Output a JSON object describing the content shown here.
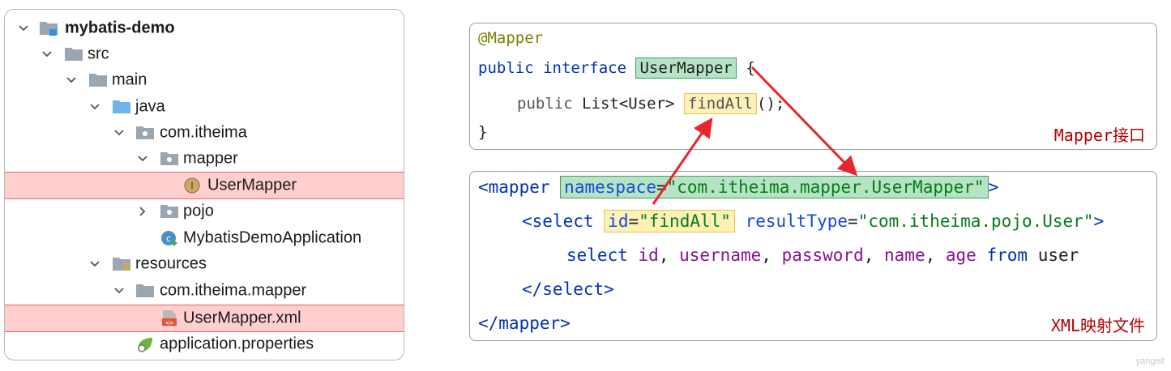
{
  "tree": {
    "items": [
      {
        "label": "mybatis-demo",
        "icon": "module-folder-icon",
        "expanded": true
      },
      {
        "label": "src",
        "icon": "folder-icon",
        "expanded": true
      },
      {
        "label": "main",
        "icon": "folder-icon",
        "expanded": true
      },
      {
        "label": "java",
        "icon": "source-folder-icon",
        "expanded": true
      },
      {
        "label": "com.itheima",
        "icon": "package-icon",
        "expanded": true
      },
      {
        "label": "mapper",
        "icon": "package-icon",
        "expanded": true
      },
      {
        "label": "UserMapper",
        "icon": "interface-icon",
        "highlighted": true
      },
      {
        "label": "pojo",
        "icon": "package-icon",
        "expanded": false
      },
      {
        "label": "MybatisDemoApplication",
        "icon": "spring-app-icon"
      },
      {
        "label": "resources",
        "icon": "resources-folder-icon",
        "expanded": true
      },
      {
        "label": "com.itheima.mapper",
        "icon": "folder-icon",
        "expanded": true
      },
      {
        "label": "UserMapper.xml",
        "icon": "xml-file-icon",
        "highlighted": true
      },
      {
        "label": "application.properties",
        "icon": "properties-file-icon"
      }
    ]
  },
  "mapper_code": {
    "annotation": "@Mapper",
    "public_interface": "public interface",
    "interface_name": "UserMapper",
    "open_brace": " {",
    "method_public": "public",
    "method_type": " List<User> ",
    "method_name": "findAll",
    "method_tail": "();",
    "close_brace": "}",
    "caption": "Mapper接口"
  },
  "xml_code": {
    "mapper_open": "<mapper",
    "ns_attr": "namespace",
    "ns_eq": "=",
    "ns_value": "\"com.itheima.mapper.UserMapper\"",
    "mapper_open_end": ">",
    "select_open": "<select",
    "id_attr": "id",
    "id_eq": "=",
    "id_value": "\"findAll\"",
    "rt_attr": "resultType",
    "rt_eq": "=",
    "rt_value": "\"com.itheima.pojo.User\"",
    "select_open_end": ">",
    "sql_select": "select",
    "sql_id": "id",
    "sql_c1": ", ",
    "sql_username": "username",
    "sql_c2": ", ",
    "sql_password": "password",
    "sql_c3": ", ",
    "sql_name": "name",
    "sql_c4": ", ",
    "sql_age": "age",
    "sql_from": "from",
    "sql_user": "user",
    "select_close": "</select>",
    "mapper_close": "</mapper>",
    "caption": "XML映射文件"
  },
  "watermark": "yangeit",
  "colors": {
    "highlight_row": "#ffcfcf",
    "green_box": "#b6e3c6",
    "yellow_box": "#fdf0b8",
    "arrow": "#e8262b",
    "caption": "#b20000"
  }
}
